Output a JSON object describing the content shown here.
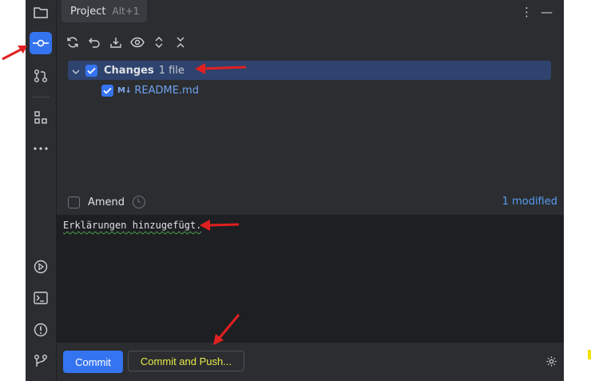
{
  "tab": {
    "title": "Project",
    "shortcut": "Alt+1"
  },
  "changes": {
    "label": "Changes",
    "count": "1 file",
    "checked": true
  },
  "files": [
    {
      "name": "README.md",
      "icon": "M↓",
      "checked": true
    }
  ],
  "amend": {
    "label": "Amend",
    "checked": false
  },
  "status": {
    "modified": "1 modified"
  },
  "commit_message": "Erklärungen hinzugefügt.",
  "buttons": {
    "commit": "Commit",
    "commit_push": "Commit and Push..."
  },
  "colors": {
    "accent": "#3574f0",
    "annotation": "#e02020",
    "highlight_text": "#e8e84a"
  }
}
